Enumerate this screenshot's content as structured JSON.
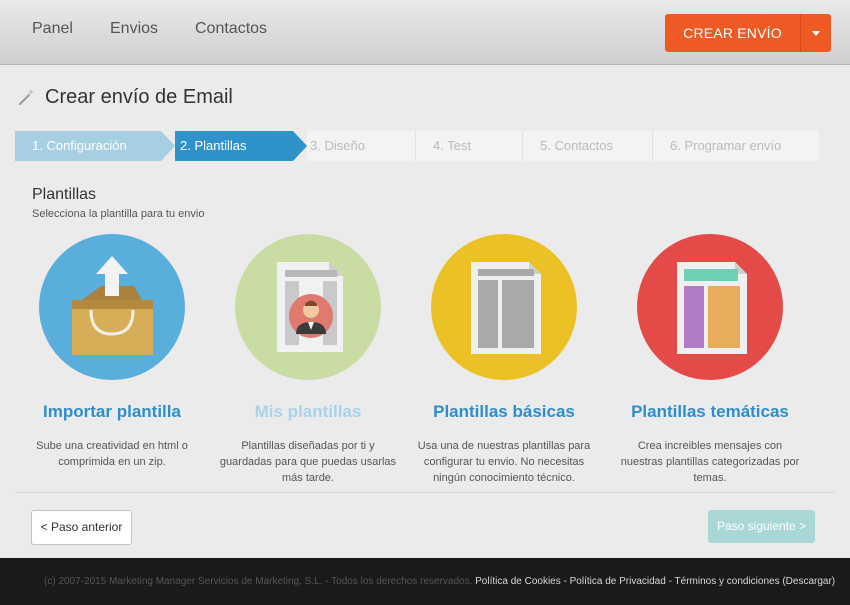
{
  "nav": {
    "items": [
      {
        "label": "Panel"
      },
      {
        "label": "Envios"
      },
      {
        "label": "Contactos"
      }
    ],
    "create_label": "CREAR ENVÍO"
  },
  "page": {
    "title": "Crear envío de Email"
  },
  "steps": [
    {
      "label": "1. Configuración",
      "state": "done"
    },
    {
      "label": "2. Plantillas",
      "state": "active"
    },
    {
      "label": "3. Diseño",
      "state": "todo"
    },
    {
      "label": "4. Test",
      "state": "todo"
    },
    {
      "label": "5. Contactos",
      "state": "todo"
    },
    {
      "label": "6. Programar envío",
      "state": "todo"
    }
  ],
  "section": {
    "title": "Plantillas",
    "subtitle": "Selecciona la plantilla para tu envio"
  },
  "options": [
    {
      "title": "Importar plantilla",
      "description": "Sube una creatividad en html o comprimida en un zip.",
      "icon": "box-upload-icon",
      "color": "#5aaedb"
    },
    {
      "title": "Mis plantillas",
      "description": "Plantillas diseñadas por ti y guardadas para que puedas usarlas más tarde.",
      "icon": "user-template-icon",
      "color": "#c9dca3"
    },
    {
      "title": "Plantillas básicas",
      "description": "Usa una de nuestras plantillas para configurar tu envio. No necesitas ningún conocimiento técnico.",
      "icon": "basic-template-icon",
      "color": "#ecc125"
    },
    {
      "title": "Plantillas temáticas",
      "description": "Crea increibles mensajes con nuestras plantillas categorizadas por temas.",
      "icon": "themed-template-icon",
      "color": "#e34a48"
    }
  ],
  "buttons": {
    "prev": "< Paso anterior",
    "next": "Paso siguiente >"
  },
  "footer": {
    "copyright": "(c) 2007-2015 Marketing Manager Servicios de Marketing, S.L. - Todos los derechos reservados.",
    "links": [
      "Política de Cookies",
      "Política de Privacidad",
      "Términos y condiciones (Descargar)"
    ]
  }
}
